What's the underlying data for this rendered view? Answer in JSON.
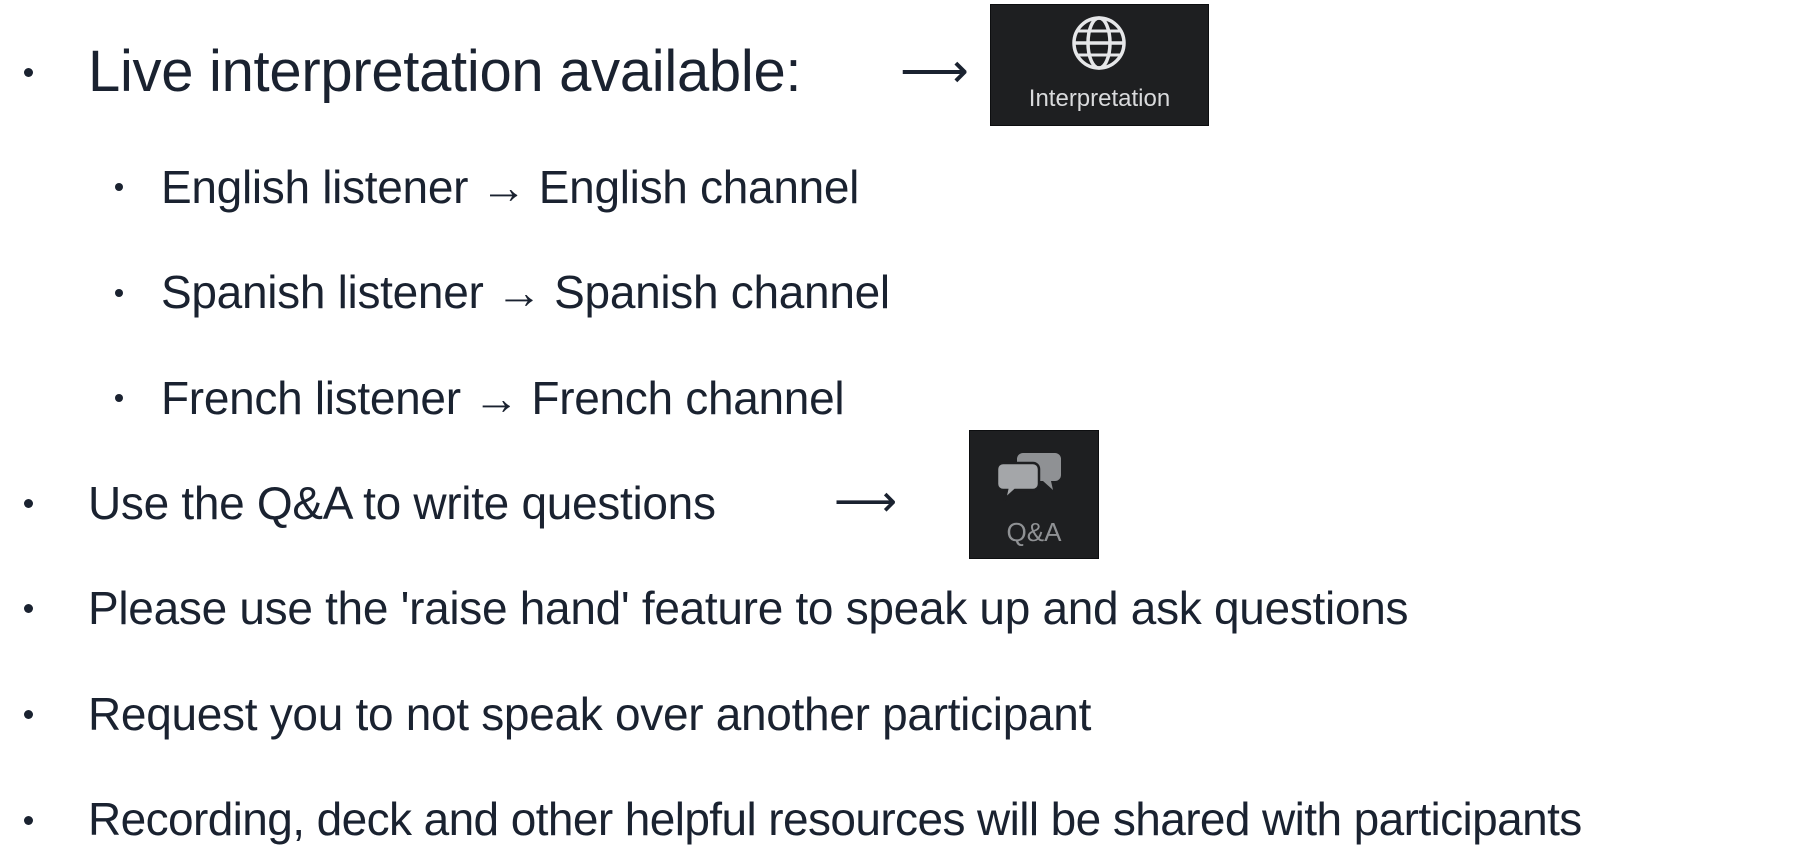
{
  "items": [
    {
      "text": "Live interpretation available:",
      "arrow": "⟶"
    },
    {
      "text": "English listener → English channel"
    },
    {
      "text": "Spanish listener → Spanish channel"
    },
    {
      "text": "French listener → French channel"
    },
    {
      "text": "Use the Q&A to write questions",
      "arrow": "⟶"
    },
    {
      "text": "Please use the 'raise hand' feature to speak up and ask questions"
    },
    {
      "text": "Request you to not speak over another participant"
    },
    {
      "text": "Recording, deck and other helpful resources will be shared with participants"
    }
  ],
  "buttons": {
    "interpretation": {
      "label": "Interpretation",
      "icon": "globe-icon"
    },
    "qa": {
      "label": "Q&A",
      "icon": "chat-bubbles-icon"
    }
  },
  "colors": {
    "text": "#1a2230",
    "button_bg": "#1e1f21",
    "button_label": "#d9dadc",
    "qa_icon": "#8f9194"
  }
}
